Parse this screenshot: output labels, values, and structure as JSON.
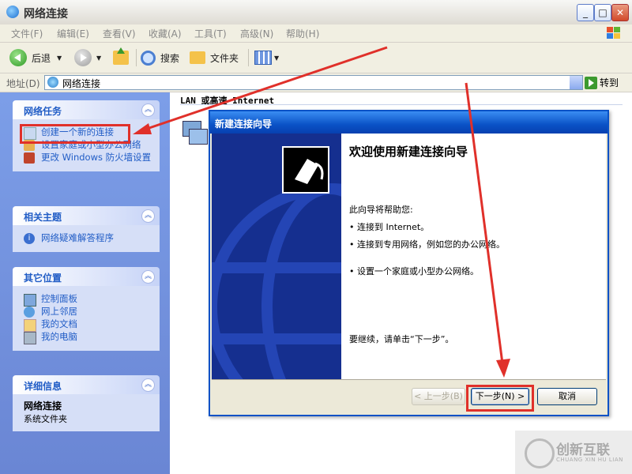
{
  "window": {
    "title": "网络连接"
  },
  "menu": [
    "文件(F)",
    "编辑(E)",
    "查看(V)",
    "收藏(A)",
    "工具(T)",
    "高级(N)",
    "帮助(H)"
  ],
  "toolbar": {
    "back": "后退",
    "search": "搜索",
    "folders": "文件夹"
  },
  "address": {
    "label": "地址(D)",
    "value": "网络连接",
    "go": "转到"
  },
  "sidebar": {
    "tasks": {
      "title": "网络任务",
      "items": [
        "创建一个新的连接",
        "设置家庭或小型办公网络",
        "更改 Windows 防火墙设置"
      ]
    },
    "related": {
      "title": "相关主题",
      "items": [
        "网络疑难解答程序"
      ]
    },
    "other": {
      "title": "其它位置",
      "items": [
        "控制面板",
        "网上邻居",
        "我的文档",
        "我的电脑"
      ]
    },
    "details": {
      "title": "详细信息",
      "name": "网络连接",
      "type": "系统文件夹"
    }
  },
  "content": {
    "group_title": "LAN 或高速 Internet"
  },
  "wizard": {
    "title": "新建连接向导",
    "heading": "欢迎使用新建连接向导",
    "intro": "此向导将帮助您:",
    "bullets": [
      "连接到 Internet。",
      "连接到专用网络，例如您的办公网络。",
      "设置一个家庭或小型办公网络。"
    ],
    "continue": "要继续，请单击“下一步”。",
    "buttons": {
      "back": "< 上一步(B)",
      "next": "下一步(N) >",
      "cancel": "取消"
    }
  },
  "watermark": {
    "name": "创新互联",
    "sub": "CHUANG XIN HU LIAN"
  },
  "colors": {
    "title_blue": "#0a52c6",
    "sidebar_blue": "#7c9ee8",
    "highlight_red": "#e0302a"
  }
}
